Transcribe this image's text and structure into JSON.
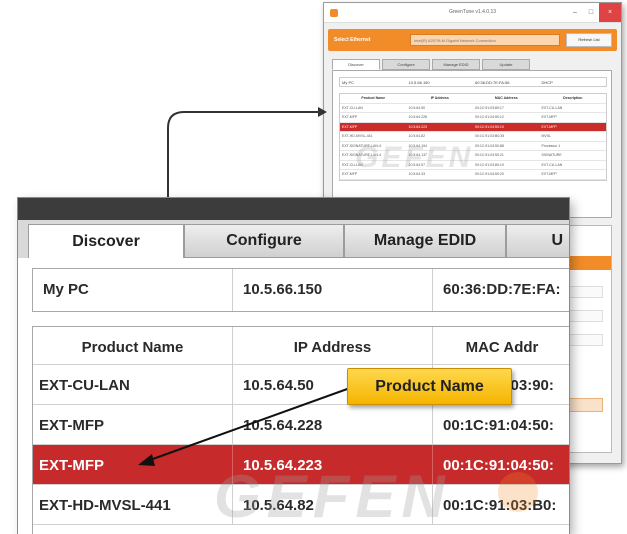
{
  "small_window": {
    "title": "GreenTune v1.4.0.13",
    "controls": [
      "–",
      "□",
      "×"
    ],
    "orange_bar": {
      "label": "Select Ethernet",
      "select_value": "Intel(R) 82579LM Gigabit Network Connection",
      "refresh_label": "Refresh List"
    },
    "tabs": [
      "Discover",
      "Configure",
      "Manage EDID",
      "Update"
    ],
    "mypc": [
      "My PC",
      "10.5.66.150",
      "60:36:DD:7E:FA:56",
      "DHCP"
    ],
    "table": {
      "headers": [
        "Product Name",
        "IP Address",
        "MAC Address",
        "Description"
      ],
      "rows": [
        [
          "EXT-CU-LAN",
          "10.5.64.50",
          "00:1C:91:03:80:17",
          "EXT-CU-LAN"
        ],
        [
          "EXT-MFP",
          "10.5.64.228",
          "00:1C:91:04:50:12",
          "EXT-MFP"
        ],
        [
          "EXT-MFP",
          "10.5.64.223",
          "00:1C:91:04:50:10",
          "EXT-MFP"
        ],
        [
          "EXT-HD-MVSL-441",
          "10.5.64.82",
          "00:1C:91:03:B0:35",
          "MVSL"
        ],
        [
          "EXT-SIGNATURE-LAN-4",
          "10.5.64.194",
          "00:1C:91:03:50:88",
          "Processor 1"
        ],
        [
          "EXT-SIGNATURE-LAN-4",
          "10.5.64.137",
          "00:1C:91:03:50:21",
          "SIGNATURE"
        ],
        [
          "EXT-CU-LAN",
          "10.5.64.57",
          "00:1C:91:03:80:19",
          "EXT-CU-LAN"
        ],
        [
          "EXT-MFP",
          "10.5.64.33",
          "00:1C:91:04:50:20",
          "EXT-MFP"
        ]
      ],
      "selected_index": 2
    },
    "watermark": "GEFEN"
  },
  "zoom": {
    "tabs": [
      "Discover",
      "Configure",
      "Manage EDID",
      "U"
    ],
    "mypc": {
      "name": "My PC",
      "ip": "10.5.66.150",
      "mac": "60:36:DD:7E:FA:"
    },
    "table": {
      "headers": [
        "Product Name",
        "IP Address",
        "MAC Addr"
      ],
      "rows": [
        {
          "name": "EXT-CU-LAN",
          "ip": "10.5.64.50",
          "mac": "00:1C:91:03:90:"
        },
        {
          "name": "EXT-MFP",
          "ip": "10.5.64.228",
          "mac": "00:1C:91:04:50:"
        },
        {
          "name": "EXT-MFP",
          "ip": "10.5.64.223",
          "mac": "00:1C:91:04:50:"
        },
        {
          "name": "EXT-HD-MVSL-441",
          "ip": "10.5.64.82",
          "mac": "00:1C:91:03:B0:"
        }
      ],
      "selected_index": 2
    },
    "watermark": "GEFEN"
  },
  "callout": {
    "label": "Product Name"
  },
  "colors": {
    "accent": "#f28c28",
    "selected_row": "#c72a2a",
    "callout": "#f4b400"
  }
}
